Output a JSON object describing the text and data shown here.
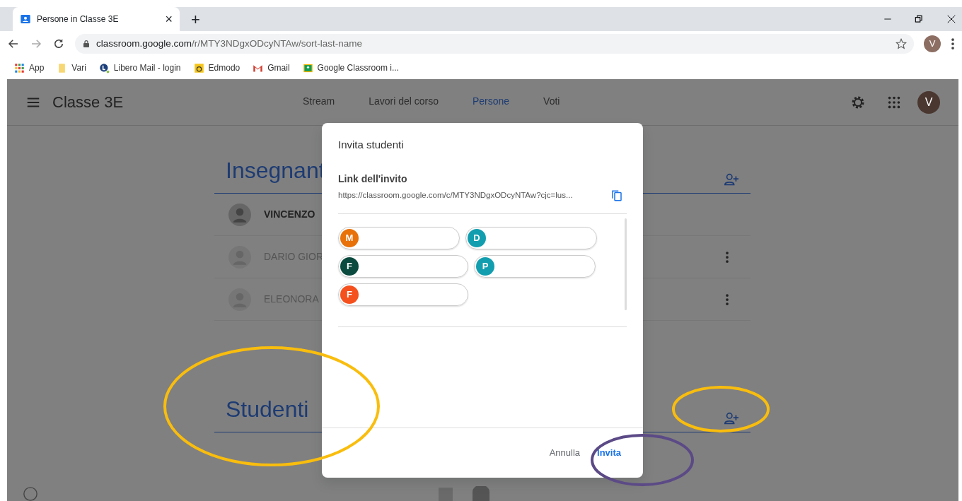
{
  "browser": {
    "tab_title": "Persone in Classe 3E",
    "tab_close": "×",
    "new_tab": "+",
    "url_host": "classroom.google.com",
    "url_path": "/r/MTY3NDgxODcyNTAw/sort-last-name",
    "profile_initial": "V",
    "bookmarks": [
      {
        "kind": "apps",
        "label": "App"
      },
      {
        "kind": "folder",
        "label": "Vari"
      },
      {
        "kind": "libero",
        "label": "Libero Mail - login"
      },
      {
        "kind": "edmodo",
        "label": "Edmodo"
      },
      {
        "kind": "gmail",
        "label": "Gmail"
      },
      {
        "kind": "classroom",
        "label": "Google Classroom i..."
      }
    ]
  },
  "header": {
    "class_name": "Classe 3E",
    "avatar_initial": "V",
    "tabs": [
      {
        "label": "Stream",
        "selected": false
      },
      {
        "label": "Lavori del corso",
        "selected": false
      },
      {
        "label": "Persone",
        "selected": true
      },
      {
        "label": "Voti",
        "selected": false
      }
    ]
  },
  "teachers": {
    "title": "Insegnant",
    "rows": [
      {
        "name": "VINCENZO",
        "pending": false
      },
      {
        "name": "DARIO GIOR",
        "pending": true
      },
      {
        "name": "ELEONORA",
        "pending": true
      }
    ]
  },
  "students": {
    "title": "Studenti"
  },
  "dialog": {
    "title": "Invita studenti",
    "link_label": "Link dell'invito",
    "link": "https://classroom.google.com/c/MTY3NDgxODcyNTAw?cjc=lus...",
    "chips": [
      {
        "initial": "M",
        "color": "#e8710a"
      },
      {
        "initial": "D",
        "color": "#129eaf"
      },
      {
        "initial": "F",
        "color": "#0b4a3e"
      },
      {
        "initial": "P",
        "color": "#129eaf"
      },
      {
        "initial": "F",
        "color": "#f4511e"
      }
    ],
    "cancel": "Annulla",
    "confirm": "Invita"
  }
}
